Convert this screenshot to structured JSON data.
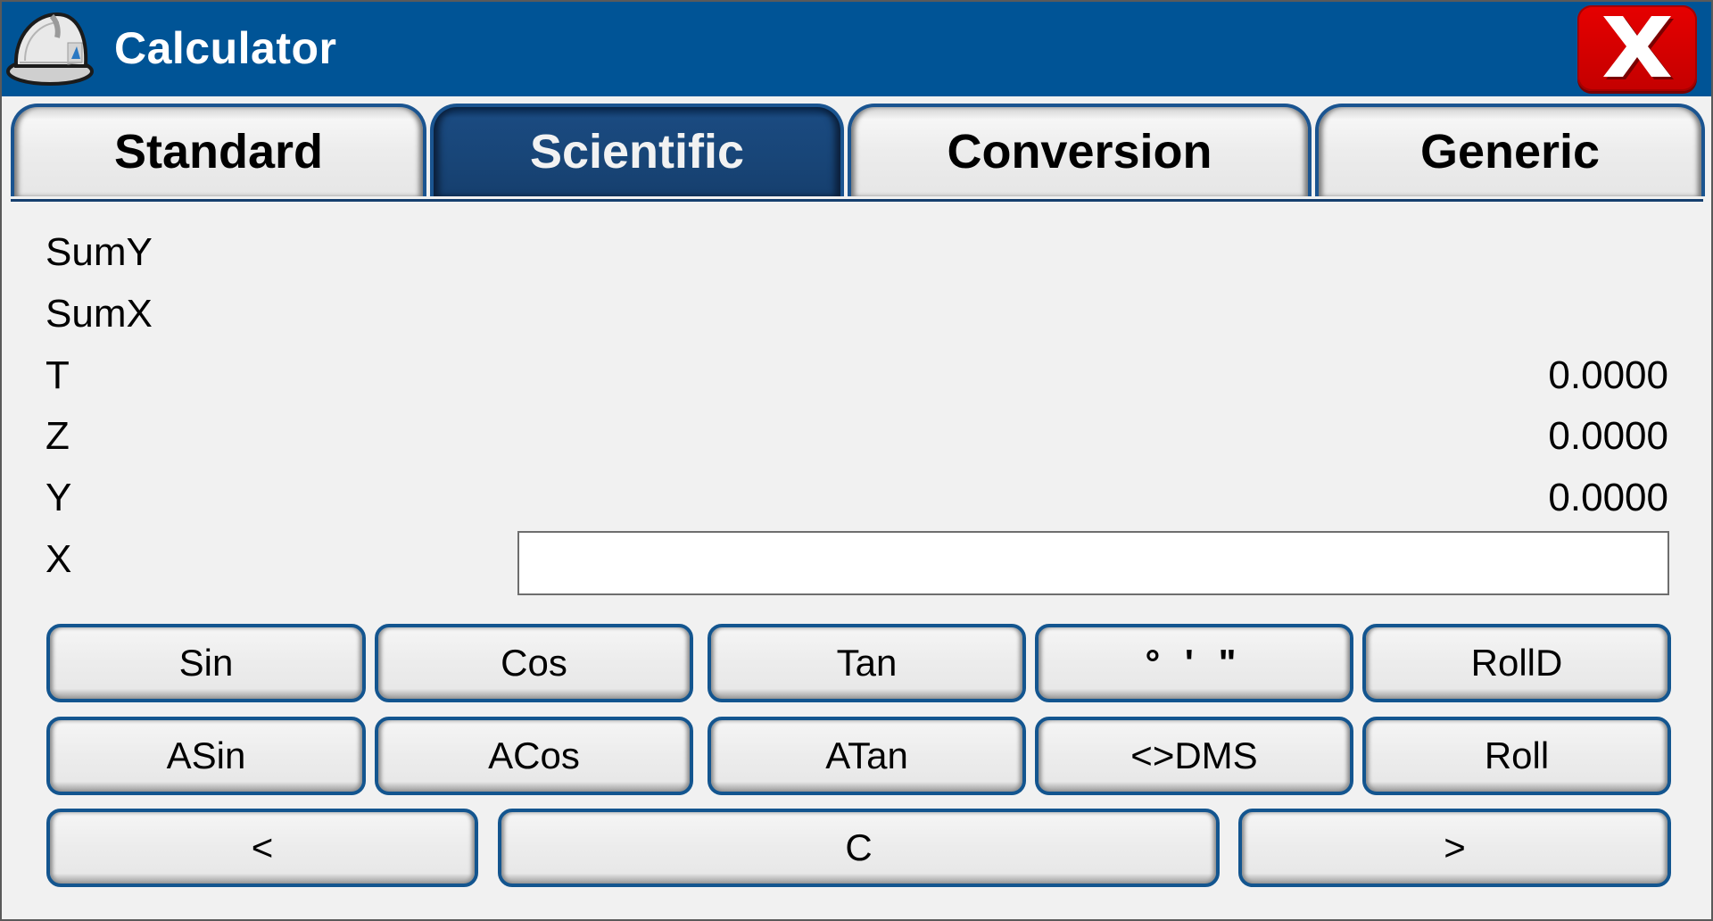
{
  "window": {
    "title": "Calculator",
    "app_icon": "hard-hat-icon",
    "close_icon": "close-x-icon"
  },
  "tabs": [
    {
      "label": "Standard",
      "active": false
    },
    {
      "label": "Scientific",
      "active": true
    },
    {
      "label": "Conversion",
      "active": false
    },
    {
      "label": "Generic",
      "active": false
    }
  ],
  "registers": [
    {
      "label": "SumY",
      "value": ""
    },
    {
      "label": "SumX",
      "value": ""
    },
    {
      "label": "T",
      "value": "0.0000"
    },
    {
      "label": "Z",
      "value": "0.0000"
    },
    {
      "label": "Y",
      "value": "0.0000"
    },
    {
      "label": "X",
      "value": ""
    }
  ],
  "x_input": {
    "value": "",
    "placeholder": ""
  },
  "buttons": {
    "row1": [
      "Sin",
      "Cos",
      "Tan",
      "° ' \"",
      "RollD"
    ],
    "row2": [
      "ASin",
      "ACos",
      "ATan",
      "<>DMS",
      "Roll"
    ],
    "row3": [
      "<",
      "C",
      ">"
    ]
  },
  "colors": {
    "titlebar": "#005496",
    "active_tab": "#184577",
    "button_border": "#13558f",
    "close_button": "#d40000"
  }
}
